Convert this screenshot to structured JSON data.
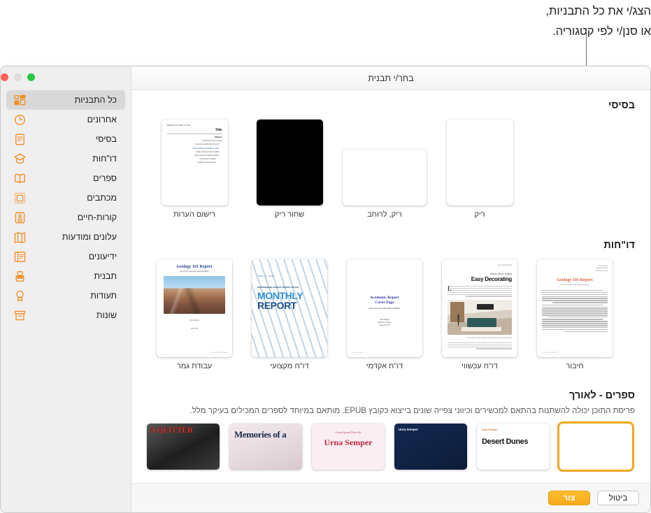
{
  "annotation": {
    "line1": "הצג/י את כל התבניות,",
    "line2": "או סנן/י לפי קטגוריה."
  },
  "window": {
    "title": "בחר/י תבנית",
    "traffic_lights": {
      "green": "#28c840",
      "gray": "#dddddd",
      "red": "#ff5f57"
    }
  },
  "sidebar": {
    "accent_color": "#f08c1e",
    "items": [
      {
        "label": "כל התבניות",
        "icon": "grid-icon",
        "active": true
      },
      {
        "label": "אחרונים",
        "icon": "clock-icon",
        "active": false
      },
      {
        "label": "בסיסי",
        "icon": "document-icon",
        "active": false
      },
      {
        "label": "דו\"חות",
        "icon": "graduation-icon",
        "active": false
      },
      {
        "label": "ספרים",
        "icon": "book-icon",
        "active": false
      },
      {
        "label": "מכתבים",
        "icon": "stamp-frame-icon",
        "active": false
      },
      {
        "label": "קורות-חיים",
        "icon": "resume-icon",
        "active": false
      },
      {
        "label": "עלונים ומודעות",
        "icon": "brochure-icon",
        "active": false
      },
      {
        "label": "ידיעונים",
        "icon": "newsletter-icon",
        "active": false
      },
      {
        "label": "תבנית",
        "icon": "rubber-stamp-icon",
        "active": false
      },
      {
        "label": "תעודות",
        "icon": "award-icon",
        "active": false
      },
      {
        "label": "שונות",
        "icon": "box-icon",
        "active": false
      }
    ]
  },
  "sections": [
    {
      "heading": "בסיסי",
      "description": "",
      "templates": [
        {
          "label": "רישום הערות",
          "art": "notes",
          "orient": "portrait"
        },
        {
          "label": "שחור ריק",
          "art": "blackblank",
          "orient": "portrait"
        },
        {
          "label": "ריק, לרוחב",
          "art": "blank",
          "orient": "landscape"
        },
        {
          "label": "ריק",
          "art": "blank",
          "orient": "portrait"
        }
      ]
    },
    {
      "heading": "דו\"חות",
      "description": "",
      "templates": [
        {
          "label": "עבודת גמר",
          "art": "geology-cover",
          "orient": "report"
        },
        {
          "label": "דו\"ח מקצועי",
          "art": "monthly-report",
          "orient": "report"
        },
        {
          "label": "דו\"ח אקדמי",
          "art": "academic-cover",
          "orient": "report"
        },
        {
          "label": "דו\"ח עכשווי",
          "art": "easy-decorating",
          "orient": "report"
        },
        {
          "label": "חיבור",
          "art": "essay",
          "orient": "report"
        }
      ]
    },
    {
      "heading": "ספרים - לאורך",
      "description": "פריסת התוכן יכולה להשתנות בהתאם למכשירים וכיווני צפייה שונים בייצוא כקובץ EPUB. מותאם במיוחד לספרים המכילים בעיקר מלל.",
      "books": [
        {
          "art": "bk1",
          "title": "A QUITTER",
          "selected": false
        },
        {
          "art": "bk2",
          "title": "Memories of a",
          "selected": false
        },
        {
          "art": "bk3",
          "kicker": "Lorem Ipsum Dolor Sit",
          "title": "Urna Semper",
          "selected": false
        },
        {
          "art": "bk4",
          "kicker": "Urna Semper",
          "title": "",
          "selected": false
        },
        {
          "art": "bk5",
          "kicker": "Urna Semper",
          "title": "Desert Dunes",
          "selected": false
        },
        {
          "art": "bk6",
          "kicker": "",
          "title": "",
          "selected": true
        }
      ]
    }
  ],
  "notes_template": {
    "date": "Wednesday, December 18, 2019",
    "title": "Title",
    "subject": "Subject",
    "bullets": [
      "Lorem ipsum dolor sit amet",
      "Consectetur adipiscing elit sed do",
      "Eiusmod tempor incididunt ut labore",
      "Magna aliqua ut enim ad minim",
      "Quis nostrud exercitation ullamco",
      "Laboris nisi ut aliquip",
      "Commodo consequat duis"
    ],
    "page": "1"
  },
  "geology_template": {
    "title": "Geology 101 Report",
    "subtitle": "Sed ut lacus quis enim mattis nonummy",
    "author": "Uma Semper",
    "term": "Fall 2019",
    "footer": "GEOLOGY 101 REPORT"
  },
  "monthly_template": {
    "date": "JUNE 17, 2020",
    "kicker": "SUSPENDISSE FEUGIAT\nMI SED LECTUS",
    "line1": "MONTHLY",
    "line2": "REPORT"
  },
  "academic_template": {
    "title_line1": "Academic Report",
    "title_line2": "Cover Page",
    "subtitle": "Sed ut lacus quis enim mattis nonummy",
    "author": "Uma Semper",
    "instructor": "Instructor's Name",
    "date": "June 20, 2020",
    "footer": "Academic Report",
    "page": "1"
  },
  "decorating_template": {
    "kicker": "Lorem Ipsum Dolor",
    "subtitle": "Simple Home Styling",
    "title": "Easy Decorating",
    "dropcap": "L",
    "caption": "Lorem ipsum dolor sit amet, ligula suspendisse nulla pretium.",
    "page": "1"
  },
  "essay_template": {
    "author": "Uma Semper",
    "instructor": "Instructor's Name",
    "date": "February 20, 2019",
    "title": "Geology 101 Report",
    "subtitle": "Sed ut lacus quis enim mattis nonummy",
    "footer": "GEOLOGY 101 REPORT",
    "page": "1"
  },
  "footer": {
    "create_label": "צור",
    "cancel_label": "ביטול",
    "create_color": "#f7a81b"
  }
}
